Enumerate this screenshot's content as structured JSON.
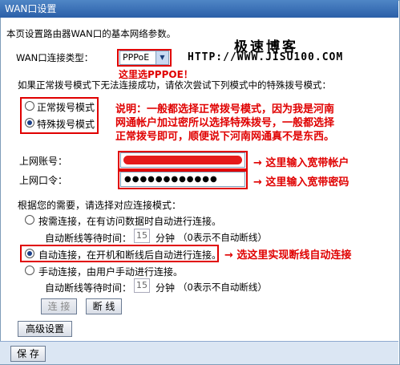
{
  "window": {
    "title": "WAN口设置"
  },
  "intro": "本页设置路由器WAN口的基本网络参数。",
  "watermark": {
    "name": "极速博客",
    "url": "HTTP://WWW.JISU100.COM"
  },
  "connection_type": {
    "label": "WAN口连接类型：",
    "value": "PPPoE",
    "annotation": "这里选PPPOE！"
  },
  "special_mode": {
    "hint": "如果正常拨号模式下无法连接成功，请依次尝试下列模式中的特殊拨号模式：",
    "options": [
      "正常拨号模式",
      "特殊拨号模式"
    ],
    "selected": 1,
    "explanation_line1": "说明：一般都选择正常拨号模式，因为我是河南",
    "explanation_line2": "网通帐户加过密所以选择特殊拨号，一般都选择",
    "explanation_line3": "正常拨号即可，顺便说下河南网通真不是东西。"
  },
  "account": {
    "label": "上网账号：",
    "annotation": "→ 这里输入宽带帐户"
  },
  "password": {
    "label": "上网口令：",
    "value": "●●●●●●●●●●●●",
    "annotation": "→ 这里输入宽带密码"
  },
  "connect_mode": {
    "heading": "根据您的需要，请选择对应连接模式：",
    "on_demand": "按需连接，在有访问数据时自动进行连接。",
    "idle_label": "自动断线等待时间：",
    "idle_value": "15",
    "idle_unit": "分钟",
    "idle_note": "（0表示不自动断线）",
    "auto": "自动连接，在开机和断线后自动进行连接。",
    "auto_annotation": "→ 选这里实现断线自动连接",
    "manual": "手动连接，由用户手动进行连接。",
    "idle_label2": "自动断线等待时间：",
    "idle_value2": "15",
    "idle_unit2": "分钟",
    "idle_note2": "（0表示不自动断线）",
    "selected": "auto"
  },
  "buttons": {
    "connect": "连 接",
    "disconnect": "断 线",
    "advanced": "高级设置",
    "save": "保 存"
  },
  "colors": {
    "accent": "#e00000",
    "title_bar": "#2b5fa8"
  }
}
